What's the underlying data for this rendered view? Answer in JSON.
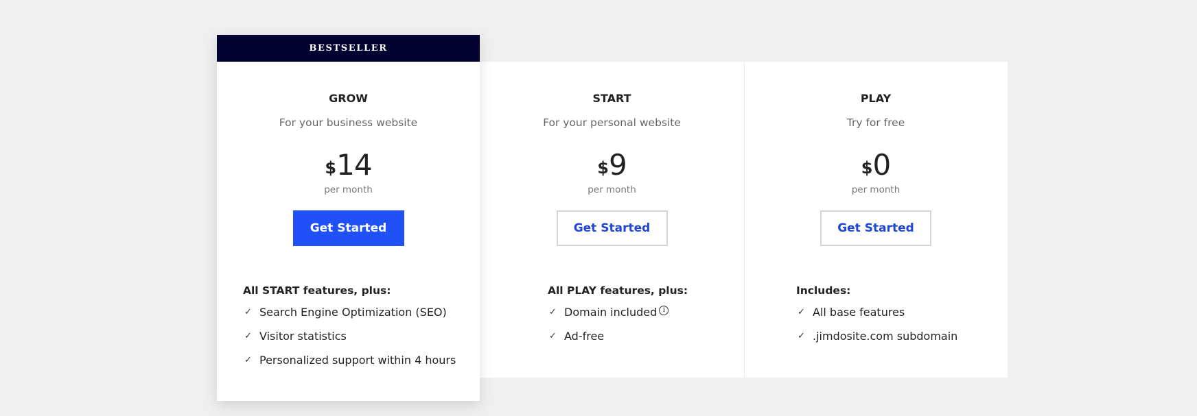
{
  "plans": [
    {
      "badge": "BESTSELLER",
      "name": "GROW",
      "tagline": "For your business website",
      "currency": "$",
      "price": "14",
      "period": "per month",
      "cta": "Get Started",
      "features_heading": "All START features, plus:",
      "features": [
        "Search Engine Optimization (SEO)",
        "Visitor statistics",
        "Personalized support within 4 hours"
      ]
    },
    {
      "name": "START",
      "tagline": "For your personal website",
      "currency": "$",
      "price": "9",
      "period": "per month",
      "cta": "Get Started",
      "features_heading": "All PLAY features, plus:",
      "features": [
        "Domain included",
        "Ad-free"
      ]
    },
    {
      "name": "PLAY",
      "tagline": "Try for free",
      "currency": "$",
      "price": "0",
      "period": "per month",
      "cta": "Get Started",
      "features_heading": "Includes:",
      "features": [
        "All base features",
        ".jimdosite.com subdomain"
      ]
    }
  ],
  "icons": {
    "check": "✓",
    "info": "i"
  },
  "colors": {
    "primary": "#2051f6",
    "badge_bg": "#020330",
    "link_blue": "#2047d4"
  }
}
